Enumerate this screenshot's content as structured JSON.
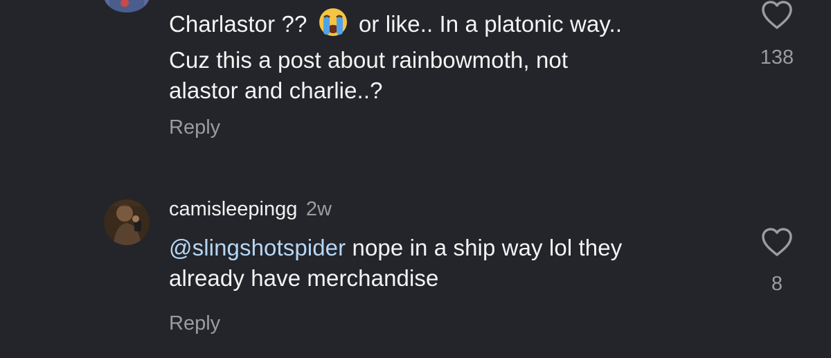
{
  "comments": [
    {
      "text_before_emoji": "Charlastor ??",
      "text_after_emoji": "or like.. In a platonic way..",
      "line2": "Cuz this a post about rainbowmoth, not",
      "line3": "alastor and charlie..?",
      "reply_label": "Reply",
      "like_count": "138"
    },
    {
      "username": "camisleepingg",
      "timestamp": "2w",
      "mention": "@slingshotspider",
      "text_line1": "nope in a ship way lol they",
      "text_line2": "already have merchandise",
      "reply_label": "Reply",
      "like_count": "8"
    }
  ],
  "icons": {
    "like": "heart-outline-icon",
    "emoji": "loudly-crying-face-emoji"
  },
  "colors": {
    "background": "#23252a",
    "text": "#f4f4f4",
    "secondary": "#9a9ca1",
    "mention": "#b7d6f5"
  }
}
